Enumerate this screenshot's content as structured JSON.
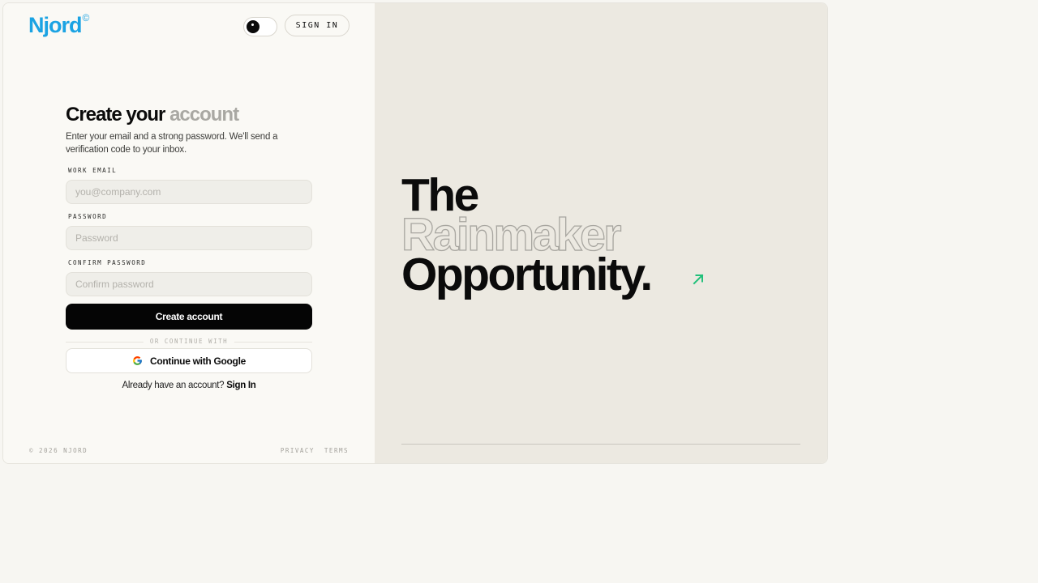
{
  "brand": {
    "name": "Njord",
    "mark": "©"
  },
  "header": {
    "sign_in_label": "SIGN IN"
  },
  "form": {
    "title_main": "Create your",
    "title_muted": "account",
    "subtitle": "Enter your email and a strong password. We'll send a verification code to your inbox.",
    "email": {
      "label": "WORK EMAIL",
      "placeholder": "you@company.com",
      "value": ""
    },
    "password": {
      "label": "PASSWORD",
      "placeholder": "Password",
      "value": ""
    },
    "confirm": {
      "label": "CONFIRM PASSWORD",
      "placeholder": "Confirm password",
      "value": ""
    },
    "submit_label": "Create account",
    "divider_label": "OR CONTINUE WITH",
    "google_label": "Continue with Google",
    "already_text": "Already have an account?",
    "sign_in_link": "Sign In"
  },
  "footer": {
    "copyright": "© 2026 NJORD",
    "links": [
      "PRIVACY",
      "TERMS"
    ]
  },
  "hero": {
    "line1": "The",
    "line2": "Rainmaker",
    "line3": "Opportunity."
  },
  "colors": {
    "brand": "#1ba3e3",
    "accent_arrow": "#22c07a",
    "primary_button": "#050505",
    "hero_background": "#ece9e1"
  },
  "icons": {
    "theme_toggle": "theme-toggle-icon",
    "google": "google-icon",
    "arrow": "arrow-up-right-icon"
  }
}
